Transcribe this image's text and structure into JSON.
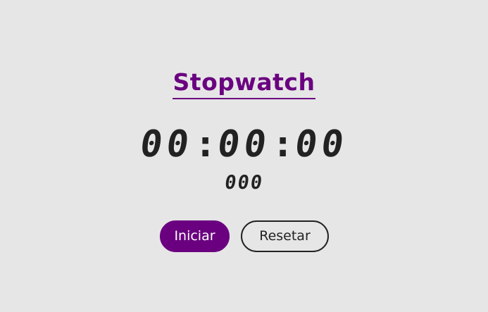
{
  "title": "Stopwatch",
  "timer": {
    "hours": "00",
    "minutes": "00",
    "seconds": "00",
    "separator": ":",
    "milliseconds": "000"
  },
  "buttons": {
    "start_label": "Iniciar",
    "reset_label": "Resetar"
  },
  "colors": {
    "background": "#e6e6e6",
    "accent": "#6a0080",
    "text": "#222222"
  }
}
